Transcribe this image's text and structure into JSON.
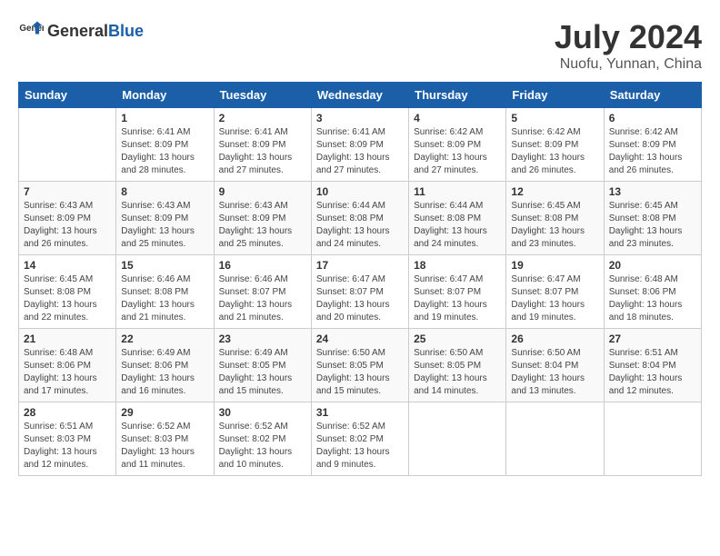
{
  "header": {
    "logo_general": "General",
    "logo_blue": "Blue",
    "month_title": "July 2024",
    "location": "Nuofu, Yunnan, China"
  },
  "weekdays": [
    "Sunday",
    "Monday",
    "Tuesday",
    "Wednesday",
    "Thursday",
    "Friday",
    "Saturday"
  ],
  "weeks": [
    [
      {
        "day": "",
        "sunrise": "",
        "sunset": "",
        "daylight": ""
      },
      {
        "day": "1",
        "sunrise": "Sunrise: 6:41 AM",
        "sunset": "Sunset: 8:09 PM",
        "daylight": "Daylight: 13 hours and 28 minutes."
      },
      {
        "day": "2",
        "sunrise": "Sunrise: 6:41 AM",
        "sunset": "Sunset: 8:09 PM",
        "daylight": "Daylight: 13 hours and 27 minutes."
      },
      {
        "day": "3",
        "sunrise": "Sunrise: 6:41 AM",
        "sunset": "Sunset: 8:09 PM",
        "daylight": "Daylight: 13 hours and 27 minutes."
      },
      {
        "day": "4",
        "sunrise": "Sunrise: 6:42 AM",
        "sunset": "Sunset: 8:09 PM",
        "daylight": "Daylight: 13 hours and 27 minutes."
      },
      {
        "day": "5",
        "sunrise": "Sunrise: 6:42 AM",
        "sunset": "Sunset: 8:09 PM",
        "daylight": "Daylight: 13 hours and 26 minutes."
      },
      {
        "day": "6",
        "sunrise": "Sunrise: 6:42 AM",
        "sunset": "Sunset: 8:09 PM",
        "daylight": "Daylight: 13 hours and 26 minutes."
      }
    ],
    [
      {
        "day": "7",
        "sunrise": "Sunrise: 6:43 AM",
        "sunset": "Sunset: 8:09 PM",
        "daylight": "Daylight: 13 hours and 26 minutes."
      },
      {
        "day": "8",
        "sunrise": "Sunrise: 6:43 AM",
        "sunset": "Sunset: 8:09 PM",
        "daylight": "Daylight: 13 hours and 25 minutes."
      },
      {
        "day": "9",
        "sunrise": "Sunrise: 6:43 AM",
        "sunset": "Sunset: 8:09 PM",
        "daylight": "Daylight: 13 hours and 25 minutes."
      },
      {
        "day": "10",
        "sunrise": "Sunrise: 6:44 AM",
        "sunset": "Sunset: 8:08 PM",
        "daylight": "Daylight: 13 hours and 24 minutes."
      },
      {
        "day": "11",
        "sunrise": "Sunrise: 6:44 AM",
        "sunset": "Sunset: 8:08 PM",
        "daylight": "Daylight: 13 hours and 24 minutes."
      },
      {
        "day": "12",
        "sunrise": "Sunrise: 6:45 AM",
        "sunset": "Sunset: 8:08 PM",
        "daylight": "Daylight: 13 hours and 23 minutes."
      },
      {
        "day": "13",
        "sunrise": "Sunrise: 6:45 AM",
        "sunset": "Sunset: 8:08 PM",
        "daylight": "Daylight: 13 hours and 23 minutes."
      }
    ],
    [
      {
        "day": "14",
        "sunrise": "Sunrise: 6:45 AM",
        "sunset": "Sunset: 8:08 PM",
        "daylight": "Daylight: 13 hours and 22 minutes."
      },
      {
        "day": "15",
        "sunrise": "Sunrise: 6:46 AM",
        "sunset": "Sunset: 8:08 PM",
        "daylight": "Daylight: 13 hours and 21 minutes."
      },
      {
        "day": "16",
        "sunrise": "Sunrise: 6:46 AM",
        "sunset": "Sunset: 8:07 PM",
        "daylight": "Daylight: 13 hours and 21 minutes."
      },
      {
        "day": "17",
        "sunrise": "Sunrise: 6:47 AM",
        "sunset": "Sunset: 8:07 PM",
        "daylight": "Daylight: 13 hours and 20 minutes."
      },
      {
        "day": "18",
        "sunrise": "Sunrise: 6:47 AM",
        "sunset": "Sunset: 8:07 PM",
        "daylight": "Daylight: 13 hours and 19 minutes."
      },
      {
        "day": "19",
        "sunrise": "Sunrise: 6:47 AM",
        "sunset": "Sunset: 8:07 PM",
        "daylight": "Daylight: 13 hours and 19 minutes."
      },
      {
        "day": "20",
        "sunrise": "Sunrise: 6:48 AM",
        "sunset": "Sunset: 8:06 PM",
        "daylight": "Daylight: 13 hours and 18 minutes."
      }
    ],
    [
      {
        "day": "21",
        "sunrise": "Sunrise: 6:48 AM",
        "sunset": "Sunset: 8:06 PM",
        "daylight": "Daylight: 13 hours and 17 minutes."
      },
      {
        "day": "22",
        "sunrise": "Sunrise: 6:49 AM",
        "sunset": "Sunset: 8:06 PM",
        "daylight": "Daylight: 13 hours and 16 minutes."
      },
      {
        "day": "23",
        "sunrise": "Sunrise: 6:49 AM",
        "sunset": "Sunset: 8:05 PM",
        "daylight": "Daylight: 13 hours and 15 minutes."
      },
      {
        "day": "24",
        "sunrise": "Sunrise: 6:50 AM",
        "sunset": "Sunset: 8:05 PM",
        "daylight": "Daylight: 13 hours and 15 minutes."
      },
      {
        "day": "25",
        "sunrise": "Sunrise: 6:50 AM",
        "sunset": "Sunset: 8:05 PM",
        "daylight": "Daylight: 13 hours and 14 minutes."
      },
      {
        "day": "26",
        "sunrise": "Sunrise: 6:50 AM",
        "sunset": "Sunset: 8:04 PM",
        "daylight": "Daylight: 13 hours and 13 minutes."
      },
      {
        "day": "27",
        "sunrise": "Sunrise: 6:51 AM",
        "sunset": "Sunset: 8:04 PM",
        "daylight": "Daylight: 13 hours and 12 minutes."
      }
    ],
    [
      {
        "day": "28",
        "sunrise": "Sunrise: 6:51 AM",
        "sunset": "Sunset: 8:03 PM",
        "daylight": "Daylight: 13 hours and 12 minutes."
      },
      {
        "day": "29",
        "sunrise": "Sunrise: 6:52 AM",
        "sunset": "Sunset: 8:03 PM",
        "daylight": "Daylight: 13 hours and 11 minutes."
      },
      {
        "day": "30",
        "sunrise": "Sunrise: 6:52 AM",
        "sunset": "Sunset: 8:02 PM",
        "daylight": "Daylight: 13 hours and 10 minutes."
      },
      {
        "day": "31",
        "sunrise": "Sunrise: 6:52 AM",
        "sunset": "Sunset: 8:02 PM",
        "daylight": "Daylight: 13 hours and 9 minutes."
      },
      {
        "day": "",
        "sunrise": "",
        "sunset": "",
        "daylight": ""
      },
      {
        "day": "",
        "sunrise": "",
        "sunset": "",
        "daylight": ""
      },
      {
        "day": "",
        "sunrise": "",
        "sunset": "",
        "daylight": ""
      }
    ]
  ]
}
